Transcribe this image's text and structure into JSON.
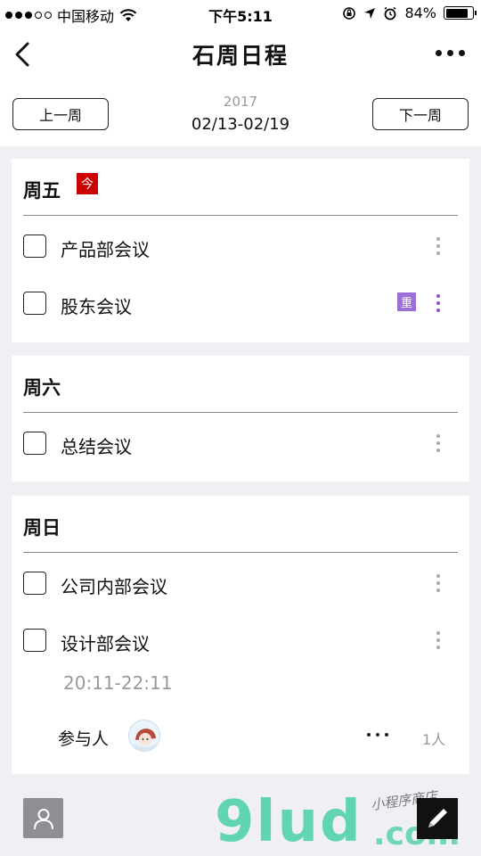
{
  "status_bar": {
    "carrier": "中国移动",
    "time": "下午5:11",
    "battery": "84%",
    "battery_level": 0.84
  },
  "nav": {
    "title": "石周日程"
  },
  "week": {
    "prev_label": "上一周",
    "next_label": "下一周",
    "year": "2017",
    "range": "02/13-02/19"
  },
  "days": [
    {
      "title": "周五",
      "today_badge": "今",
      "items": [
        {
          "label": "产品部会议"
        },
        {
          "label": "股东会议",
          "badge": "重"
        }
      ]
    },
    {
      "title": "周六",
      "items": [
        {
          "label": "总结会议"
        }
      ]
    },
    {
      "title": "周日",
      "items": [
        {
          "label": "公司内部会议"
        },
        {
          "label": "设计部会议",
          "time": "20:11-22:11",
          "participants_label": "参与人",
          "participants_count": "1人"
        }
      ]
    }
  ],
  "watermark": {
    "main": "9lud",
    "suffix": ".com",
    "script": "小程序商店"
  },
  "colors": {
    "today_badge": "#cc0000",
    "important_badge": "#9b6fd6",
    "watermark": "#5ad3ae"
  }
}
